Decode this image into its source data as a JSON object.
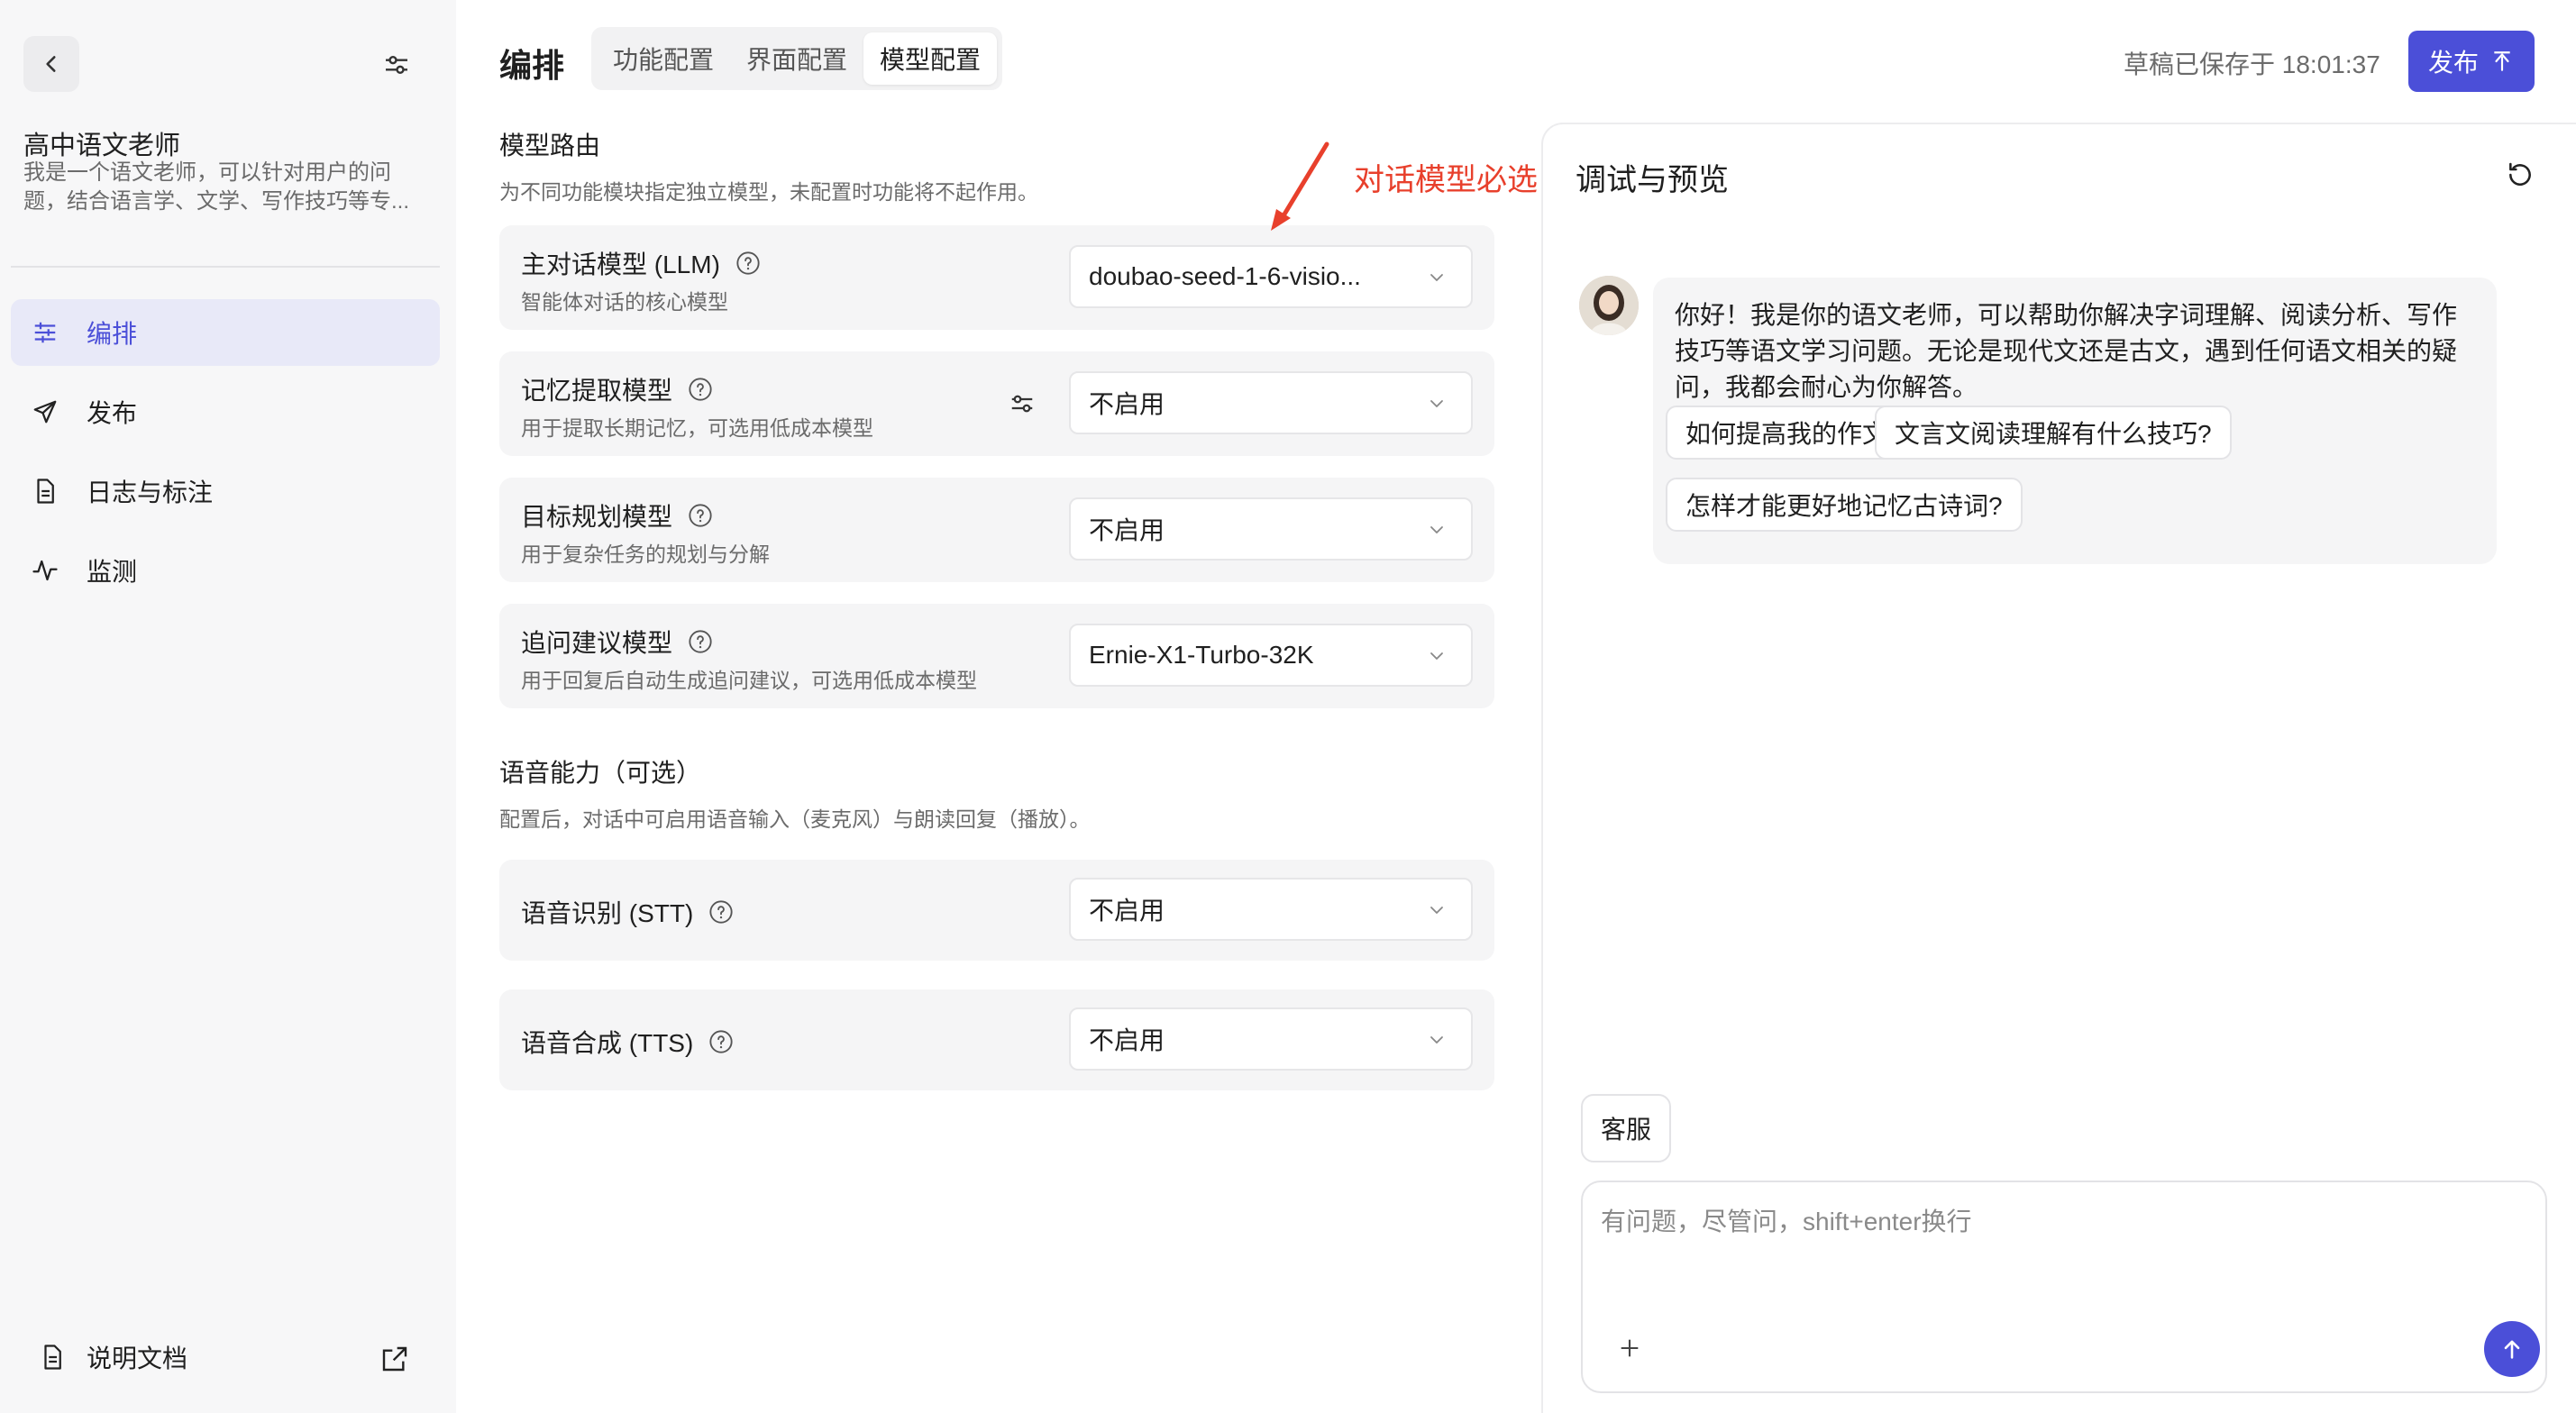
{
  "sidebar": {
    "agent_name": "高中语文老师",
    "agent_desc": "我是一个语文老师，可以针对用户的问题，结合语言学、文学、写作技巧等专...",
    "nav": [
      {
        "label": "编排",
        "icon": "sliders-icon",
        "active": true
      },
      {
        "label": "发布",
        "icon": "send-icon"
      },
      {
        "label": "日志与标注",
        "icon": "document-icon"
      },
      {
        "label": "监测",
        "icon": "pulse-icon"
      }
    ],
    "doc_link": "说明文档"
  },
  "header": {
    "title": "编排",
    "tabs": [
      {
        "label": "功能配置"
      },
      {
        "label": "界面配置"
      },
      {
        "label": "模型配置",
        "active": true
      }
    ],
    "draft_status": "草稿已保存于 18:01:37",
    "publish_label": "发布",
    "accent": "#4b4fd8"
  },
  "model_routing": {
    "title": "模型路由",
    "desc": "为不同功能模块指定独立模型，未配置时功能将不起作用。",
    "rows": [
      {
        "title": "主对话模型 (LLM)",
        "sub": "智能体对话的核心模型",
        "value": "doubao-seed-1-6-visio..."
      },
      {
        "title": "记忆提取模型",
        "sub": "用于提取长期记忆，可选用低成本模型",
        "value": "不启用"
      },
      {
        "title": "目标规划模型",
        "sub": "用于复杂任务的规划与分解",
        "value": "不启用"
      },
      {
        "title": "追问建议模型",
        "sub": "用于回复后自动生成追问建议，可选用低成本模型",
        "value": "Ernie-X1-Turbo-32K"
      }
    ]
  },
  "voice": {
    "title": "语音能力（可选）",
    "desc": "配置后，对话中可启用语音输入（麦克风）与朗读回复（播放）。",
    "rows": [
      {
        "title": "语音识别 (STT)",
        "value": "不启用"
      },
      {
        "title": "语音合成 (TTS)",
        "value": "不启用"
      }
    ]
  },
  "annotation": {
    "text": "对话模型必选",
    "color": "#e8402c"
  },
  "preview": {
    "title": "调试与预览",
    "greeting": "你好！我是你的语文老师，可以帮助你解决字词理解、阅读分析、写作技巧等语文学习问题。无论是现代文还是古文，遇到任何语文相关的疑问，我都会耐心为你解答。",
    "suggestions": [
      "如何提高我的作文写作水平?",
      "文言文阅读理解有什么技巧?",
      "怎样才能更好地记忆古诗词?"
    ],
    "service_label": "客服",
    "input_placeholder": "有问题，尽管问，shift+enter换行"
  }
}
